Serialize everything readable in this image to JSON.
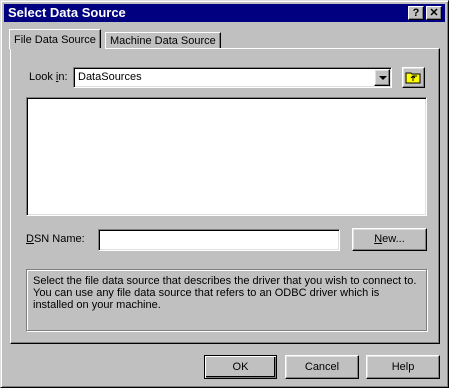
{
  "window": {
    "title": "Select Data Source",
    "help_glyph": "?",
    "close_glyph": "✕"
  },
  "tabs": [
    {
      "label": "File Data Source"
    },
    {
      "label": "Machine Data Source"
    }
  ],
  "look_in": {
    "label_pre": "Look ",
    "label_key": "i",
    "label_post": "n:",
    "value": "DataSources"
  },
  "dsn": {
    "label_key": "D",
    "label_rest": "SN Name:",
    "value": ""
  },
  "new_button": {
    "label_key": "N",
    "label_rest": "ew..."
  },
  "info_text": "Select the file data source that describes the driver that you wish to connect to. You can use any file data source that refers to an ODBC driver which is installed on your machine.",
  "buttons": {
    "ok": "OK",
    "cancel": "Cancel",
    "help": "Help"
  },
  "icons": {
    "up_folder": "up-folder-icon",
    "dropdown": "chevron-down-icon"
  }
}
